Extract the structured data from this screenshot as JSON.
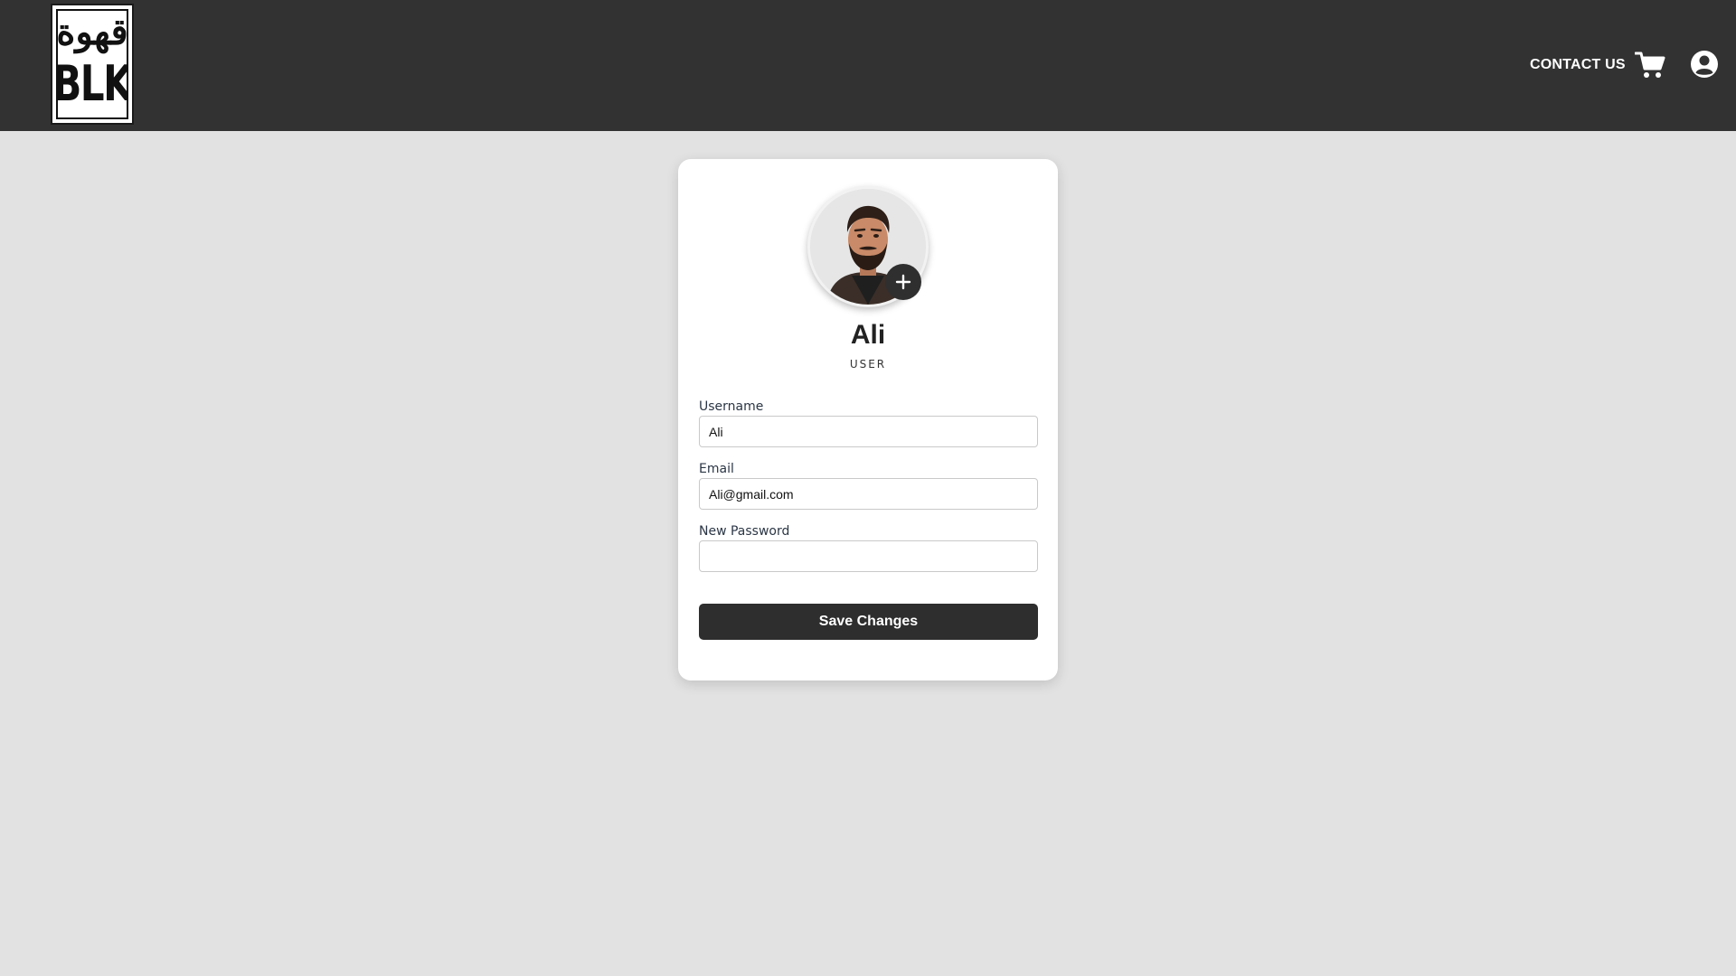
{
  "header": {
    "logo_arabic": "قهوة",
    "logo_text": "BLK",
    "contact_label": "CONTACT US",
    "cart_icon": "cart-icon",
    "account_icon": "user-circle-icon"
  },
  "profile": {
    "avatar_icon": "avatar-portrait",
    "add_photo_icon": "plus-icon",
    "name": "Ali",
    "role": "USER"
  },
  "form": {
    "username_label": "Username",
    "username_value": "Ali",
    "email_label": "Email",
    "email_value": "Ali@gmail.com",
    "password_label": "New Password",
    "password_value": "",
    "save_label": "Save Changes"
  },
  "colors": {
    "header_bg": "#323232",
    "page_bg": "#e2e2e2",
    "card_bg": "#ffffff",
    "button_bg": "#2e2e2e"
  }
}
